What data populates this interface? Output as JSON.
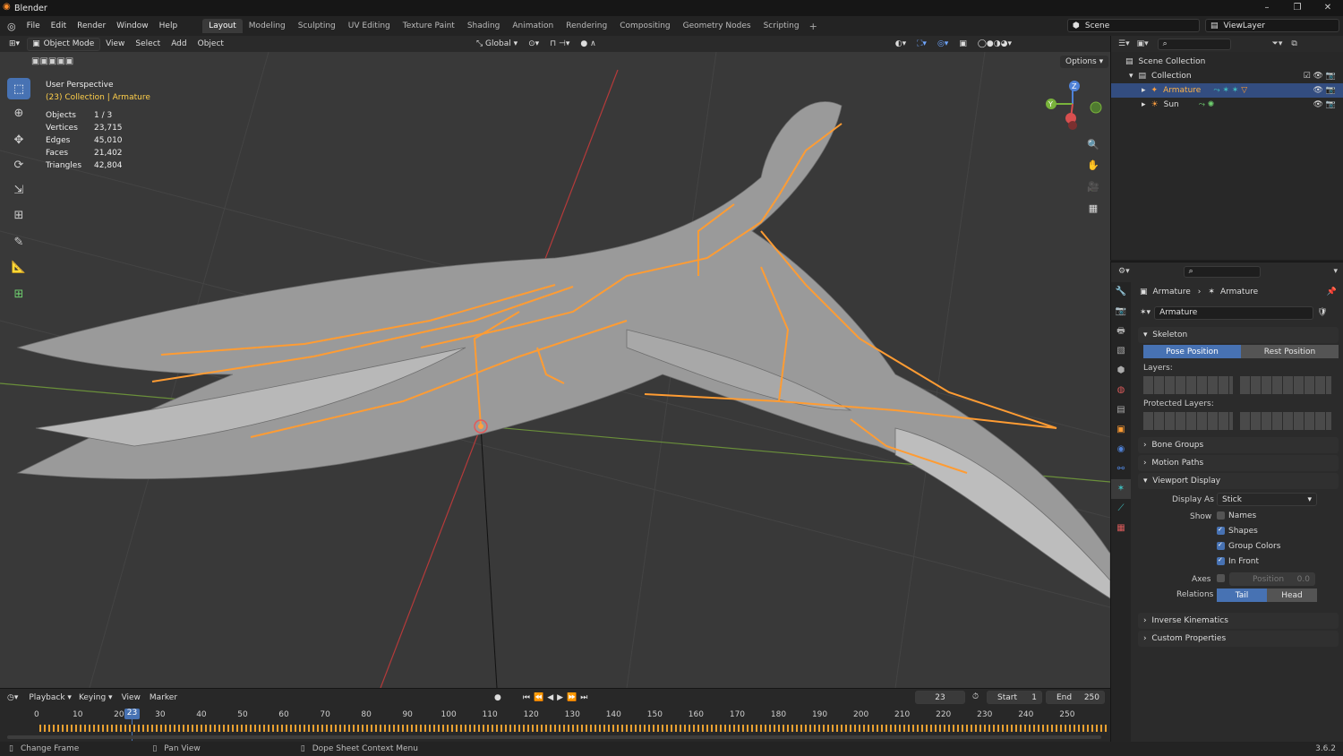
{
  "window": {
    "title": "Blender",
    "min": "–",
    "max": "❐",
    "close": "✕"
  },
  "menu": [
    "File",
    "Edit",
    "Render",
    "Window",
    "Help"
  ],
  "workspaces": [
    "Layout",
    "Modeling",
    "Sculpting",
    "UV Editing",
    "Texture Paint",
    "Shading",
    "Animation",
    "Rendering",
    "Compositing",
    "Geometry Nodes",
    "Scripting"
  ],
  "workspace_active": "Layout",
  "scene": "Scene",
  "view_layer": "ViewLayer",
  "viewport_header": {
    "mode": "Object Mode",
    "view": "View",
    "select": "Select",
    "add": "Add",
    "object": "Object",
    "transform": "Global",
    "options": "Options"
  },
  "overlay": {
    "perspective": "User Perspective",
    "collection": "(23) Collection | Armature",
    "stats": [
      {
        "k": "Objects",
        "v": "1 / 3"
      },
      {
        "k": "Vertices",
        "v": "23,715"
      },
      {
        "k": "Edges",
        "v": "45,010"
      },
      {
        "k": "Faces",
        "v": "21,402"
      },
      {
        "k": "Triangles",
        "v": "42,804"
      }
    ]
  },
  "gizmo": {
    "x": "X",
    "y": "Y",
    "z": "Z"
  },
  "outliner": {
    "root": "Scene Collection",
    "collection": "Collection",
    "items": [
      "Armature",
      "Sun"
    ]
  },
  "properties": {
    "crumb1": "Armature",
    "crumb2": "Armature",
    "data_name": "Armature",
    "skeleton": "Skeleton",
    "pose": "Pose Position",
    "rest": "Rest Position",
    "layers": "Layers:",
    "protected": "Protected Layers:",
    "bone_groups": "Bone Groups",
    "motion_paths": "Motion Paths",
    "viewport_display": "Viewport Display",
    "display_as_label": "Display As",
    "display_as": "Stick",
    "show": "Show",
    "names": "Names",
    "shapes": "Shapes",
    "group_colors": "Group Colors",
    "in_front": "In Front",
    "axes": "Axes",
    "position": "Position",
    "position_val": "0.0",
    "relations": "Relations",
    "tail": "Tail",
    "head": "Head",
    "ik": "Inverse Kinematics",
    "custom": "Custom Properties"
  },
  "timeline": {
    "playback": "Playback",
    "keying": "Keying",
    "view": "View",
    "marker": "Marker",
    "current": "23",
    "start_label": "Start",
    "start": "1",
    "end_label": "End",
    "end": "250",
    "ticks": [
      "0",
      "10",
      "20",
      "30",
      "40",
      "50",
      "60",
      "70",
      "80",
      "90",
      "100",
      "110",
      "120",
      "130",
      "140",
      "150",
      "160",
      "170",
      "180",
      "190",
      "200",
      "210",
      "220",
      "230",
      "240",
      "250"
    ]
  },
  "status": {
    "a": "Change Frame",
    "b": "Pan View",
    "c": "Dope Sheet Context Menu",
    "version": "3.6.2"
  }
}
